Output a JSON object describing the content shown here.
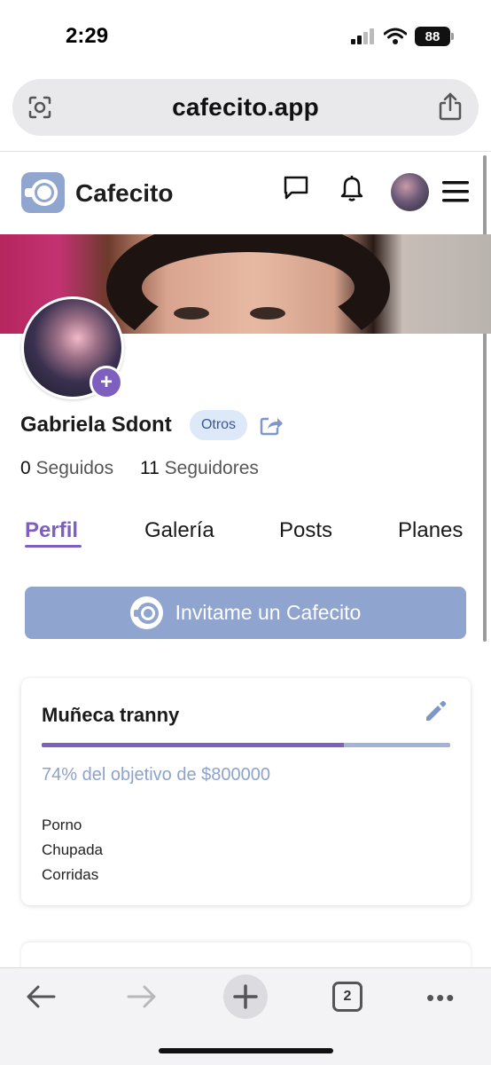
{
  "status_bar": {
    "time": "2:29",
    "battery": "88"
  },
  "browser": {
    "url": "cafecito.app"
  },
  "header": {
    "brand": "Cafecito"
  },
  "profile": {
    "name": "Gabriela Sdont",
    "badge": "Otros",
    "following_count": "0",
    "following_label": "Seguidos",
    "followers_count": "11",
    "followers_label": "Seguidores"
  },
  "tabs": [
    {
      "label": "Perfil",
      "active": true
    },
    {
      "label": "Galería",
      "active": false
    },
    {
      "label": "Posts",
      "active": false
    },
    {
      "label": "Planes",
      "active": false
    }
  ],
  "invite_button": {
    "label": "Invitame un Cafecito"
  },
  "goal_card": {
    "title": "Muñeca tranny",
    "progress_percent": 74,
    "goal_text": "74% del objetivo de $800000",
    "items": [
      "Porno",
      "Chupada",
      "Corridas"
    ]
  },
  "toolbar": {
    "tab_count": "2"
  },
  "colors": {
    "accent": "#7e5fc0",
    "button": "#8fa4cf",
    "goal_text": "#8fa2c9",
    "badge_bg": "#dde8f8"
  }
}
